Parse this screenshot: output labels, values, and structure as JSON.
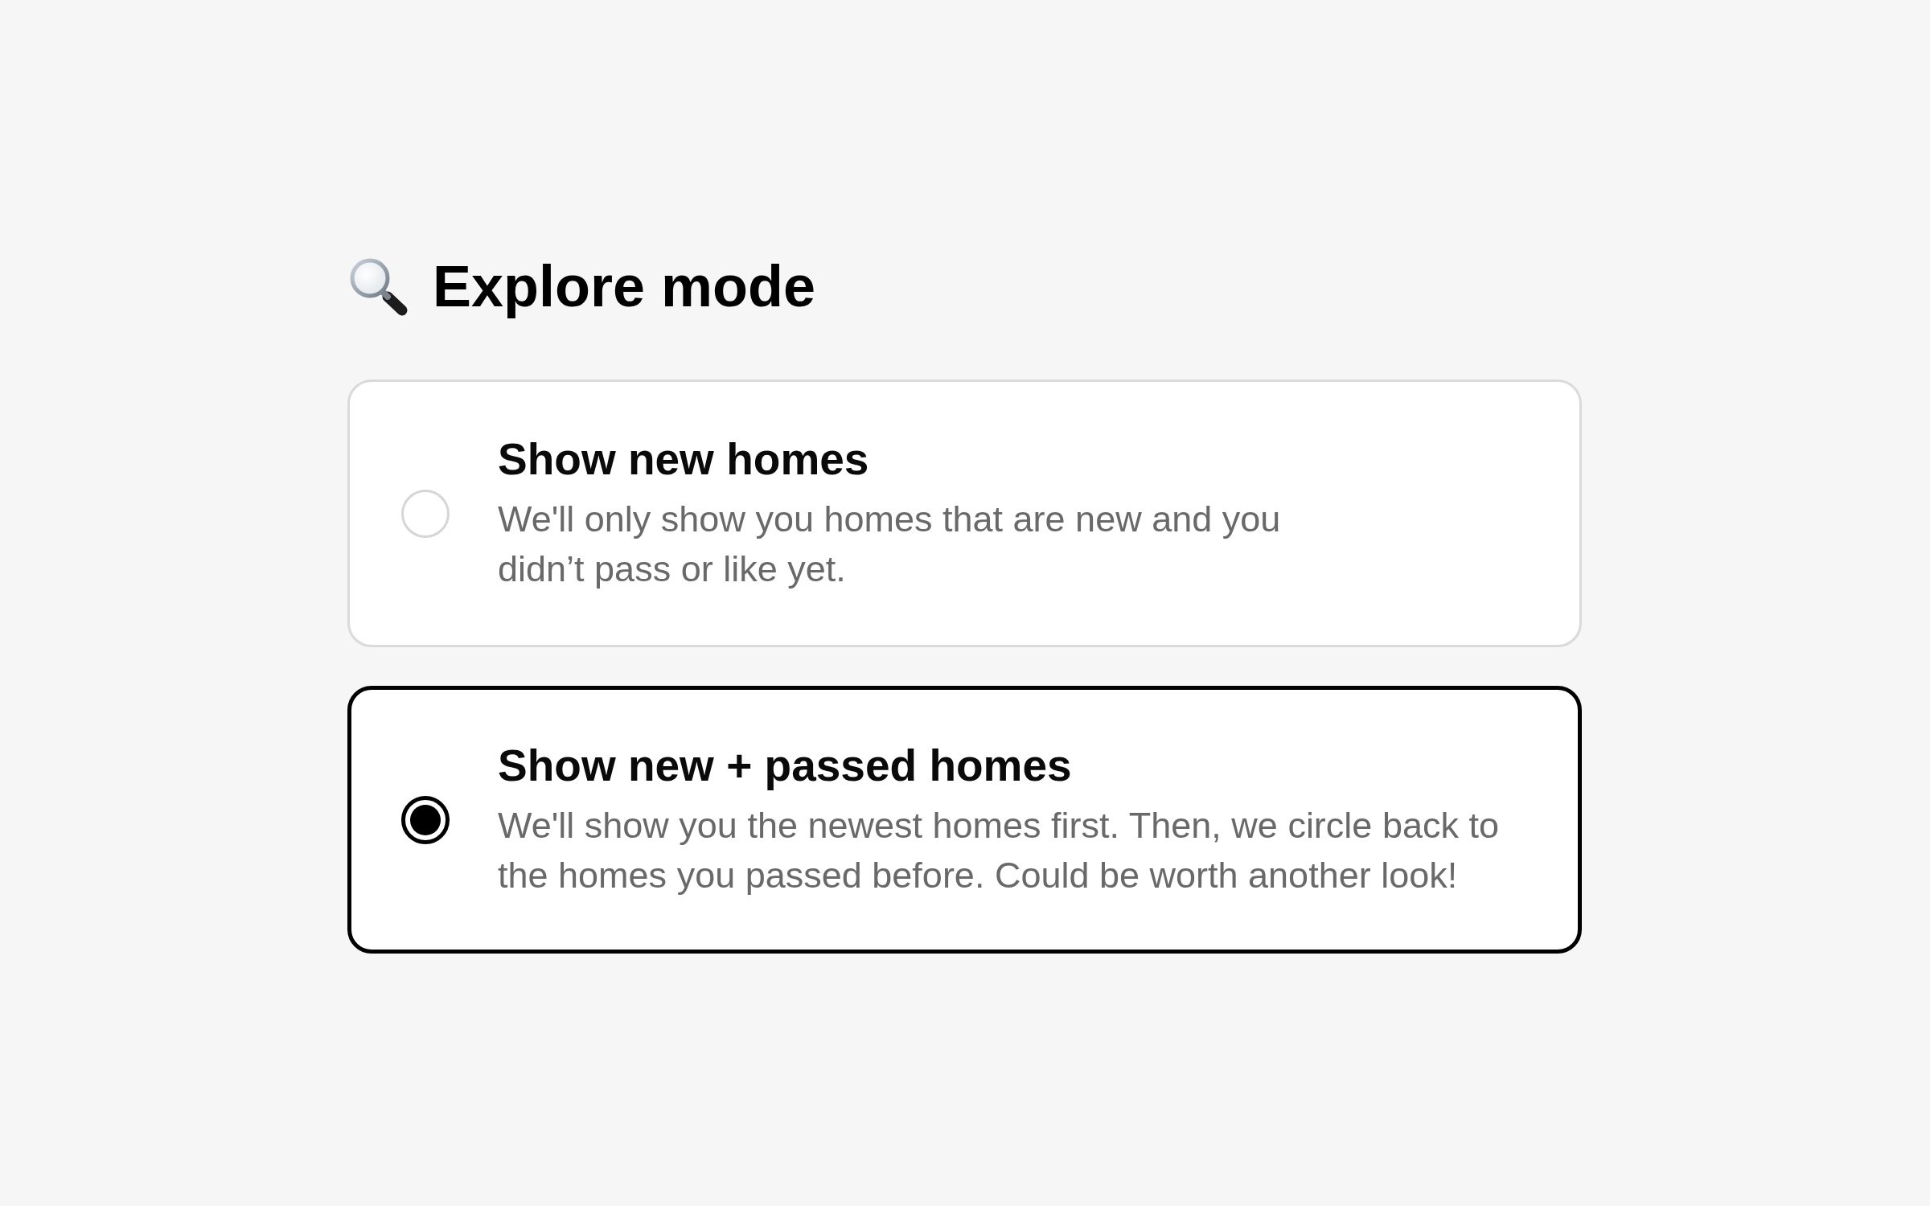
{
  "heading": {
    "title": "Explore mode"
  },
  "options": [
    {
      "title": "Show new homes",
      "description": "We'll only show you homes that are new and you\ndidn’t pass or like yet.",
      "selected": false
    },
    {
      "title": "Show new + passed homes",
      "description": "We'll show you the newest homes first. Then, we circle back to\nthe homes you passed before. Could be worth another look!",
      "selected": true
    }
  ]
}
